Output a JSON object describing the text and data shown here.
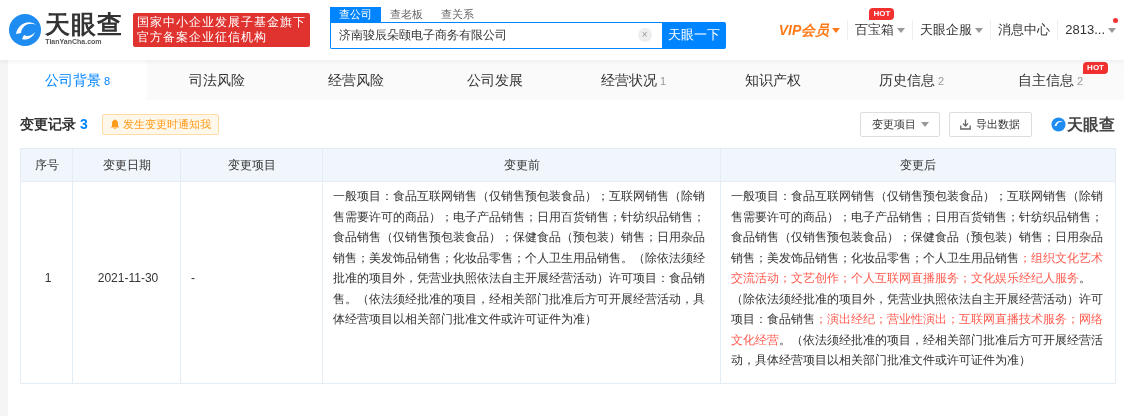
{
  "header": {
    "logo": {
      "name": "天眼查",
      "domain": "TianYanCha.com"
    },
    "badge_lines": [
      "国家中小企业发展子基金旗下",
      "官方备案企业征信机构"
    ],
    "search": {
      "tabs": [
        {
          "label": "查公司",
          "selected": true
        },
        {
          "label": "查老板",
          "selected": false
        },
        {
          "label": "查关系",
          "selected": false
        }
      ],
      "value": "济南骏辰朵颐电子商务有限公司",
      "clear": "×",
      "button": "天眼一下"
    },
    "nav": [
      {
        "label": "VIP会员",
        "kind": "vip",
        "dropdown": true,
        "dot": false
      },
      {
        "label": "百宝箱",
        "kind": "plain",
        "dropdown": true,
        "hot_label": "HOT",
        "dot": false
      },
      {
        "label": "天眼企服",
        "kind": "plain",
        "dropdown": true,
        "dot": false
      },
      {
        "label": "消息中心",
        "kind": "plain",
        "dropdown": false,
        "dot": false
      },
      {
        "label": "2813...",
        "kind": "plain",
        "dropdown": true,
        "dot": true
      }
    ]
  },
  "tabs": [
    {
      "label": "公司背景",
      "count": "8",
      "selected": true
    },
    {
      "label": "司法风险",
      "selected": false
    },
    {
      "label": "经营风险",
      "selected": false
    },
    {
      "label": "公司发展",
      "selected": false
    },
    {
      "label": "经营状况",
      "count": "1",
      "selected": false
    },
    {
      "label": "知识产权",
      "selected": false
    },
    {
      "label": "历史信息",
      "count": "2",
      "selected": false
    },
    {
      "label": "自主信息",
      "count": "2",
      "selected": false,
      "hot": "HOT"
    }
  ],
  "section": {
    "title": "变更记录",
    "count": "3",
    "notify": "发生变更时通知我",
    "filter": "变更项目",
    "export": "导出数据",
    "brand": "天眼查"
  },
  "table": {
    "columns": [
      "序号",
      "变更日期",
      "变更项目",
      "变更前",
      "变更后"
    ],
    "rows": [
      {
        "index": "1",
        "date": "2021-11-30",
        "item": "-",
        "before": "一般项目：食品互联网销售（仅销售预包装食品）；互联网销售（除销售需要许可的商品）；电子产品销售；日用百货销售；针纺织品销售；食品销售（仅销售预包装食品）；保健食品（预包装）销售；日用杂品销售；美发饰品销售；化妆品零售；个人卫生用品销售。（除依法须经批准的项目外，凭营业执照依法自主开展经营活动）许可项目：食品销售。（依法须经批准的项目，经相关部门批准后方可开展经营活动，具体经营项目以相关部门批准文件或许可证件为准）",
        "after": [
          {
            "text": "一般项目：食品互联网销售（仅销售预包装食品）；互联网销售（除销售需要许可的商品）；电子产品销售；日用百货销售；针纺织品销售；食品销售（仅销售预包装食品）；保健食品（预包装）销售；日用杂品销售；美发饰品销售；化妆品零售；个人卫生用品销售",
            "highlight": false
          },
          {
            "text": "；组织文化艺术交流活动；文艺创作；个人互联网直播服务；文化娱乐经纪人服务",
            "highlight": true
          },
          {
            "text": "。（除依法须经批准的项目外，凭营业执照依法自主开展经营活动）许可项目：食品销售",
            "highlight": false
          },
          {
            "text": "；演出经纪；营业性演出；互联网直播技术服务；网络文化经营",
            "highlight": true
          },
          {
            "text": "。（依法须经批准的项目，经相关部门批准后方可开展经营活动，具体经营项目以相关部门批准文件或许可证件为准）",
            "highlight": false
          }
        ]
      }
    ]
  }
}
